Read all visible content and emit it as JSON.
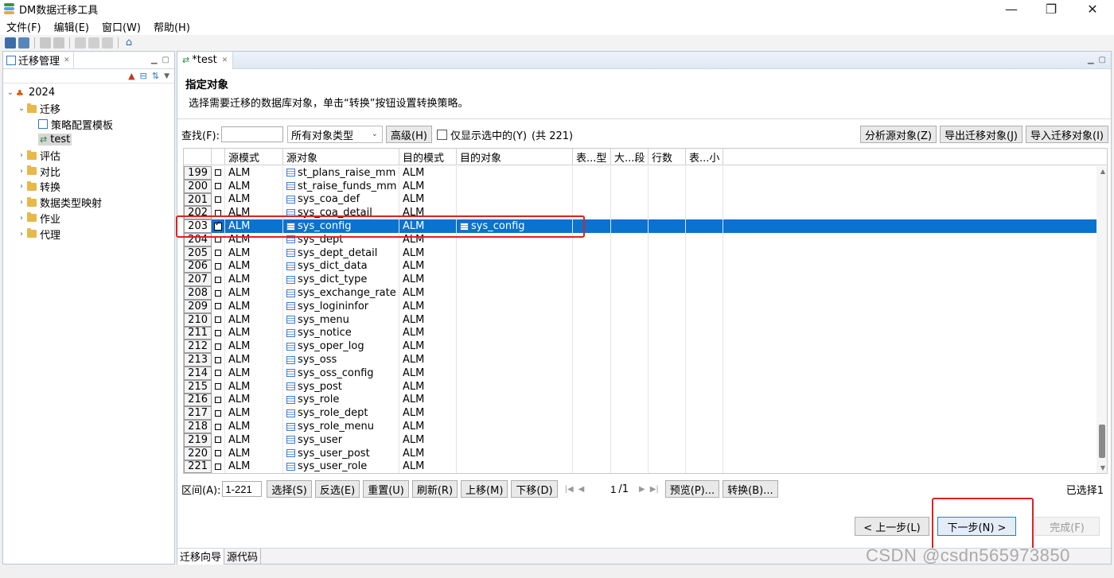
{
  "window": {
    "title": "DM数据迁移工具",
    "minimize": "—",
    "restore": "❐",
    "close": "✕"
  },
  "menu": [
    "文件(F)",
    "编辑(E)",
    "窗口(W)",
    "帮助(H)"
  ],
  "left_panel": {
    "tab_label": "迁移管理",
    "tree": [
      {
        "label": "2024",
        "level": 0,
        "twisty": "⌄"
      },
      {
        "label": "迁移",
        "level": 1,
        "twisty": "⌄"
      },
      {
        "label": "策略配置模板",
        "level": 2,
        "twisty": ""
      },
      {
        "label": "test",
        "level": 2,
        "twisty": "",
        "selected": true
      },
      {
        "label": "评估",
        "level": 1,
        "twisty": "›"
      },
      {
        "label": "对比",
        "level": 1,
        "twisty": "›"
      },
      {
        "label": "转换",
        "level": 1,
        "twisty": "›"
      },
      {
        "label": "数据类型映射",
        "level": 1,
        "twisty": "›"
      },
      {
        "label": "作业",
        "level": 1,
        "twisty": "›"
      },
      {
        "label": "代理",
        "level": 1,
        "twisty": "›"
      }
    ]
  },
  "editor": {
    "tab_label": "*test",
    "heading": "指定对象",
    "description": "选择需要迁移的数据库对象，单击“转换”按钮设置转换策略。",
    "filter": {
      "find_label": "查找(F):",
      "find_value": "",
      "type_select": "所有对象类型",
      "advanced_button": "高级(H)",
      "show_selected_label": "仅显示选中的(Y)",
      "total": "(共 221)",
      "analyze_button": "分析源对象(Z)",
      "export_button": "导出迁移对象(J)",
      "import_button": "导入迁移对象(I)"
    },
    "table": {
      "columns": [
        "源模式",
        "源对象",
        "目的模式",
        "目的对象",
        "表...型",
        "大...段",
        "行数",
        "表...小"
      ],
      "rows": [
        {
          "num": "199",
          "checked": false,
          "src_schema": "ALM",
          "src_object": "st_plans_raise_mm",
          "dst_schema": "ALM",
          "dst_object": ""
        },
        {
          "num": "200",
          "checked": false,
          "src_schema": "ALM",
          "src_object": "st_raise_funds_mm",
          "dst_schema": "ALM",
          "dst_object": ""
        },
        {
          "num": "201",
          "checked": false,
          "src_schema": "ALM",
          "src_object": "sys_coa_def",
          "dst_schema": "ALM",
          "dst_object": ""
        },
        {
          "num": "202",
          "checked": false,
          "src_schema": "ALM",
          "src_object": "sys_coa_detail",
          "dst_schema": "ALM",
          "dst_object": ""
        },
        {
          "num": "203",
          "checked": true,
          "selected": true,
          "src_schema": "ALM",
          "src_object": "sys_config",
          "dst_schema": "ALM",
          "dst_object": "sys_config"
        },
        {
          "num": "204",
          "checked": false,
          "src_schema": "ALM",
          "src_object": "sys_dept",
          "dst_schema": "ALM",
          "dst_object": ""
        },
        {
          "num": "205",
          "checked": false,
          "src_schema": "ALM",
          "src_object": "sys_dept_detail",
          "dst_schema": "ALM",
          "dst_object": ""
        },
        {
          "num": "206",
          "checked": false,
          "src_schema": "ALM",
          "src_object": "sys_dict_data",
          "dst_schema": "ALM",
          "dst_object": ""
        },
        {
          "num": "207",
          "checked": false,
          "src_schema": "ALM",
          "src_object": "sys_dict_type",
          "dst_schema": "ALM",
          "dst_object": ""
        },
        {
          "num": "208",
          "checked": false,
          "src_schema": "ALM",
          "src_object": "sys_exchange_rate",
          "dst_schema": "ALM",
          "dst_object": ""
        },
        {
          "num": "209",
          "checked": false,
          "src_schema": "ALM",
          "src_object": "sys_logininfor",
          "dst_schema": "ALM",
          "dst_object": ""
        },
        {
          "num": "210",
          "checked": false,
          "src_schema": "ALM",
          "src_object": "sys_menu",
          "dst_schema": "ALM",
          "dst_object": ""
        },
        {
          "num": "211",
          "checked": false,
          "src_schema": "ALM",
          "src_object": "sys_notice",
          "dst_schema": "ALM",
          "dst_object": ""
        },
        {
          "num": "212",
          "checked": false,
          "src_schema": "ALM",
          "src_object": "sys_oper_log",
          "dst_schema": "ALM",
          "dst_object": ""
        },
        {
          "num": "213",
          "checked": false,
          "src_schema": "ALM",
          "src_object": "sys_oss",
          "dst_schema": "ALM",
          "dst_object": ""
        },
        {
          "num": "214",
          "checked": false,
          "src_schema": "ALM",
          "src_object": "sys_oss_config",
          "dst_schema": "ALM",
          "dst_object": ""
        },
        {
          "num": "215",
          "checked": false,
          "src_schema": "ALM",
          "src_object": "sys_post",
          "dst_schema": "ALM",
          "dst_object": ""
        },
        {
          "num": "216",
          "checked": false,
          "src_schema": "ALM",
          "src_object": "sys_role",
          "dst_schema": "ALM",
          "dst_object": ""
        },
        {
          "num": "217",
          "checked": false,
          "src_schema": "ALM",
          "src_object": "sys_role_dept",
          "dst_schema": "ALM",
          "dst_object": ""
        },
        {
          "num": "218",
          "checked": false,
          "src_schema": "ALM",
          "src_object": "sys_role_menu",
          "dst_schema": "ALM",
          "dst_object": ""
        },
        {
          "num": "219",
          "checked": false,
          "src_schema": "ALM",
          "src_object": "sys_user",
          "dst_schema": "ALM",
          "dst_object": ""
        },
        {
          "num": "220",
          "checked": false,
          "src_schema": "ALM",
          "src_object": "sys_user_post",
          "dst_schema": "ALM",
          "dst_object": ""
        },
        {
          "num": "221",
          "checked": false,
          "src_schema": "ALM",
          "src_object": "sys_user_role",
          "dst_schema": "ALM",
          "dst_object": ""
        }
      ]
    },
    "bottom": {
      "range_label": "区间(A):",
      "range_value": "1-221",
      "select": "选择(S)",
      "invert": "反选(E)",
      "reset": "重置(U)",
      "refresh": "刷新(R)",
      "move_up": "上移(M)",
      "move_down": "下移(D)",
      "page_value": "1",
      "page_total": "/1",
      "preview": "预览(P)...",
      "convert": "转换(B)...",
      "selected_count": "已选择1"
    },
    "wizard": {
      "back": "< 上一步(L)",
      "next": "下一步(N) >",
      "finish": "完成(F)"
    },
    "bottom_tabs": [
      "迁移向导",
      "源代码"
    ]
  },
  "watermark": "CSDN @csdn565973850",
  "colors": {
    "selection": "#0a72cf",
    "highlight_box": "#e02020"
  }
}
